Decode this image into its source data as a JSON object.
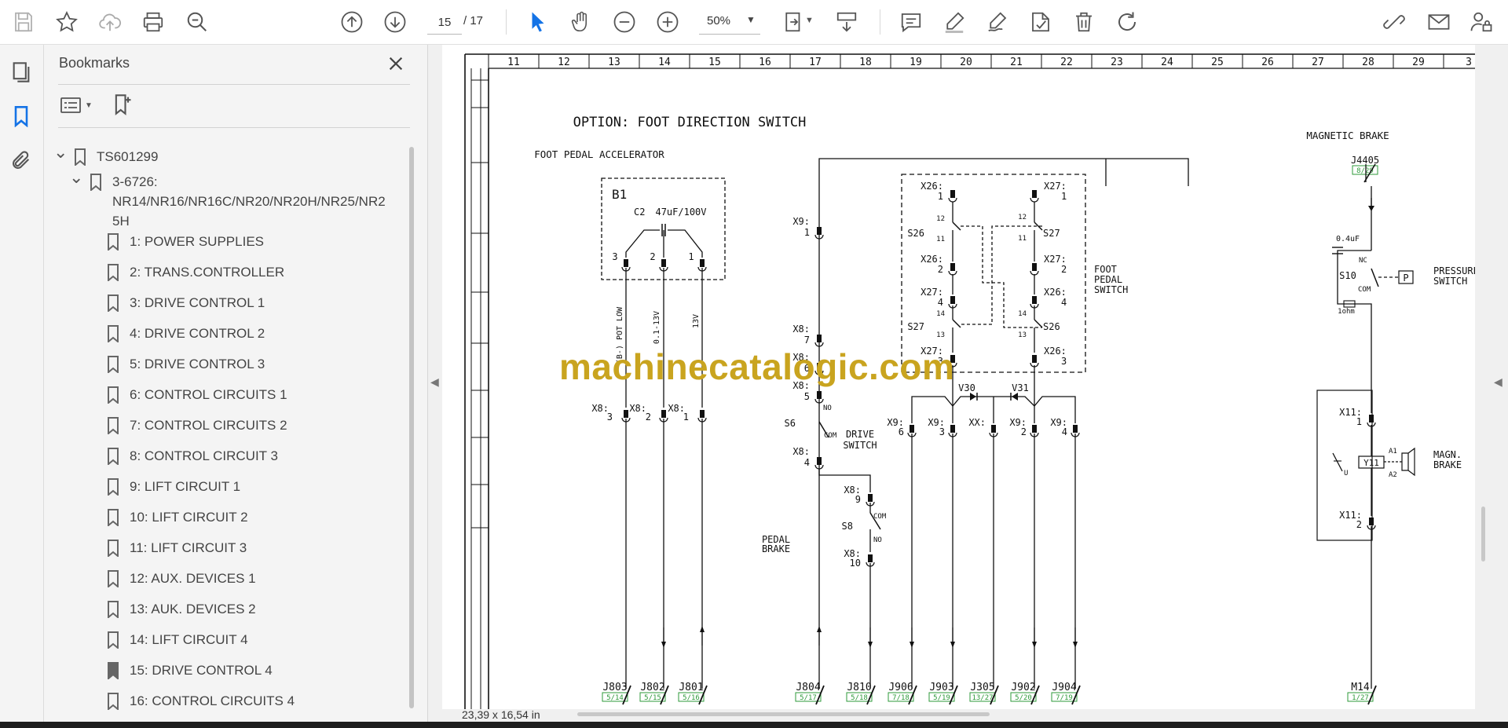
{
  "toolbar": {
    "icons": [
      "save-icon",
      "star-icon",
      "cloud-upload-icon",
      "print-icon",
      "zoom-search-icon",
      "page-up-icon",
      "page-down-icon",
      "select-arrow-icon",
      "hand-icon",
      "zoom-out-icon",
      "zoom-in-icon",
      "fit-page-icon",
      "scroll-mode-icon",
      "comment-icon",
      "highlight-pen-icon",
      "draw-icon",
      "stamp-icon",
      "delete-icon",
      "rotate-icon",
      "share-link-icon",
      "email-icon",
      "account-lock-icon"
    ],
    "current_page": "15",
    "total_pages": "/ 17",
    "zoom": "50%"
  },
  "bookmarks_panel": {
    "title": "Bookmarks",
    "root": "TS601299",
    "group": "3-6726:",
    "group_line2": "NR14/NR16/NR16C/NR20/NR20H/NR25/NR2",
    "group_line3": "5H",
    "items": [
      "1: POWER SUPPLIES",
      "2: TRANS.CONTROLLER",
      "3: DRIVE CONTROL 1",
      "4: DRIVE CONTROL 2",
      "5: DRIVE CONTROL 3",
      "6: CONTROL CIRCUITS 1",
      "7: CONTROL CIRCUITS 2",
      "8: CONTROL CIRCUIT 3",
      "9: LIFT CIRCUIT 1",
      "10: LIFT CIRCUIT 2",
      "11: LIFT CIRCUIT 3",
      "12: AUX. DEVICES 1",
      "13: AUK. DEVICES 2",
      "14: LIFT CIRCUIT 4",
      "15: DRIVE CONTROL 4",
      "16: CONTROL CIRCUITS 4"
    ]
  },
  "document": {
    "page_size": "23,39 x 16,54 in",
    "watermark": "machinecatalogic.com",
    "columns": [
      "11",
      "12",
      "13",
      "14",
      "15",
      "16",
      "17",
      "18",
      "19",
      "20",
      "21",
      "22",
      "23",
      "24",
      "25",
      "26",
      "27",
      "28",
      "29",
      "3"
    ],
    "title": "OPTION: FOOT DIRECTION SWITCH",
    "foot_pedal_accel": "FOOT PEDAL ACCELERATOR",
    "magnetic_brake_title": "MAGNETIC BRAKE",
    "b1": "B1",
    "c2": "C2",
    "cap_value": "47uF/100V",
    "pins_b1": [
      "3",
      "2",
      "1"
    ],
    "wire_labels": [
      "(B-) POT LOW",
      "0.1-13V",
      "13V"
    ],
    "x8": "X8:",
    "x9": "X9:",
    "x26": "X26:",
    "x27": "X27:",
    "x11": "X11:",
    "xx": "XX:",
    "s26": "S26",
    "s27": "S27",
    "s6": "S6",
    "s8": "S8",
    "s10": "S10",
    "v30": "V30",
    "v31": "V31",
    "y11": "Y11",
    "foot_pedal_switch": [
      "FOOT",
      "PEDAL",
      "SWITCH"
    ],
    "drive_switch": [
      "DRIVE",
      "SWITCH"
    ],
    "pedal_brake": [
      "PEDAL",
      "BRAKE"
    ],
    "pressure_switch": [
      "PRESSURE",
      "SWITCH"
    ],
    "magn_brake": [
      "MAGN.",
      "BRAKE"
    ],
    "j4405": "J4405",
    "cap_04": "0.4uF",
    "ohm": "1ohm",
    "nc": "NC",
    "com": "COM",
    "no": "NO",
    "p": "P",
    "a1": "A1",
    "a2": "A2",
    "u": "U",
    "n": {
      "1": "1",
      "2": "2",
      "3": "3",
      "4": "4",
      "5": "5",
      "6": "6",
      "7": "7",
      "9": "9",
      "10": "10",
      "11": "11",
      "12": "12",
      "13": "13",
      "14": "14"
    },
    "connectors": [
      "J803",
      "J802",
      "J801",
      "J804",
      "J810",
      "J906",
      "J903",
      "J305",
      "J902",
      "J904",
      "M14"
    ],
    "refs": {
      "J803": "5/14",
      "J802": "5/15",
      "J801": "5/16",
      "J804": "5/17",
      "J810": "5/18",
      "J906": "7/18",
      "J903": "5/19",
      "J305": "13/27",
      "J902": "5/20",
      "J904": "7/19",
      "M14": "1/27",
      "J4405": "8/29"
    }
  },
  "colors": {
    "accent": "#1473e6",
    "watermark": "#c9a41f",
    "ref_green": "#2e9a3a"
  }
}
